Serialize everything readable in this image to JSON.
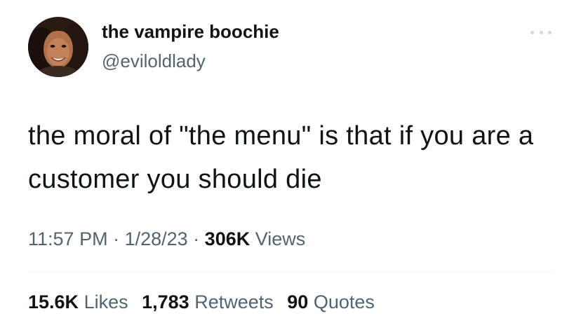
{
  "author": {
    "display_name": "the vampire boochie",
    "handle": "@eviloldlady",
    "avatar_icon": "profile-photo"
  },
  "tweet": {
    "text": "the moral of \"the menu\" is that if you are a customer you should die",
    "time": "11:57 PM",
    "separator": " · ",
    "date": "1/28/23",
    "views_count": "306K",
    "views_label": " Views"
  },
  "stats": {
    "likes_count": "15.6K",
    "likes_label": " Likes",
    "retweets_count": "1,783",
    "retweets_label": " Retweets",
    "quotes_count": "90",
    "quotes_label": " Quotes"
  },
  "colors": {
    "text_primary": "#0f1419",
    "text_secondary": "#536471",
    "divider": "#eff3f4"
  }
}
